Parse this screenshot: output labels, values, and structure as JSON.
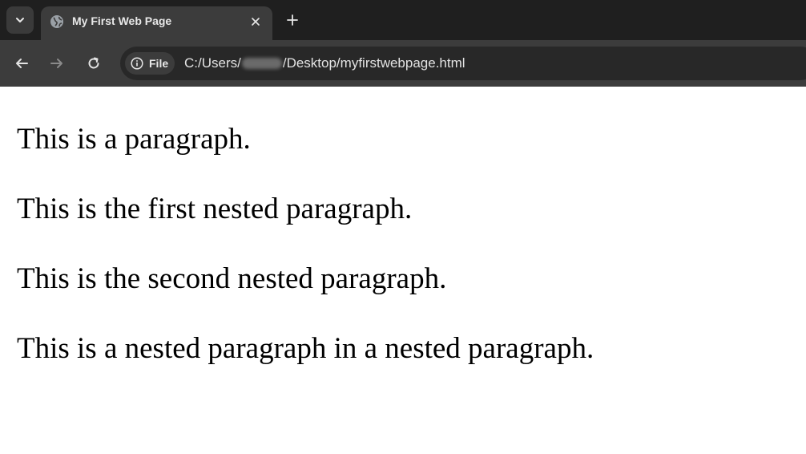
{
  "browser": {
    "tab": {
      "title": "My First Web Page",
      "favicon": "globe-icon"
    },
    "buttons": {
      "tab_search": "chevron-down-icon",
      "close_tab": "close-icon",
      "new_tab": "plus-icon",
      "back": "arrow-left-icon",
      "forward": "arrow-right-icon",
      "reload": "reload-icon"
    },
    "address_bar": {
      "chip_label": "File",
      "chip_icon": "info-icon",
      "url_prefix": "C:/Users/",
      "url_suffix": "/Desktop/myfirstwebpage.html"
    }
  },
  "page": {
    "paragraphs": [
      "This is a paragraph.",
      "This is the first nested paragraph.",
      "This is the second nested paragraph.",
      "This is a nested paragraph in a nested paragraph."
    ]
  },
  "colors": {
    "tabstrip_bg": "#1f1f1f",
    "toolbar_bg": "#3c3c3c",
    "omnibox_bg": "#282828",
    "page_bg": "#ffffff",
    "text": "#000000"
  }
}
